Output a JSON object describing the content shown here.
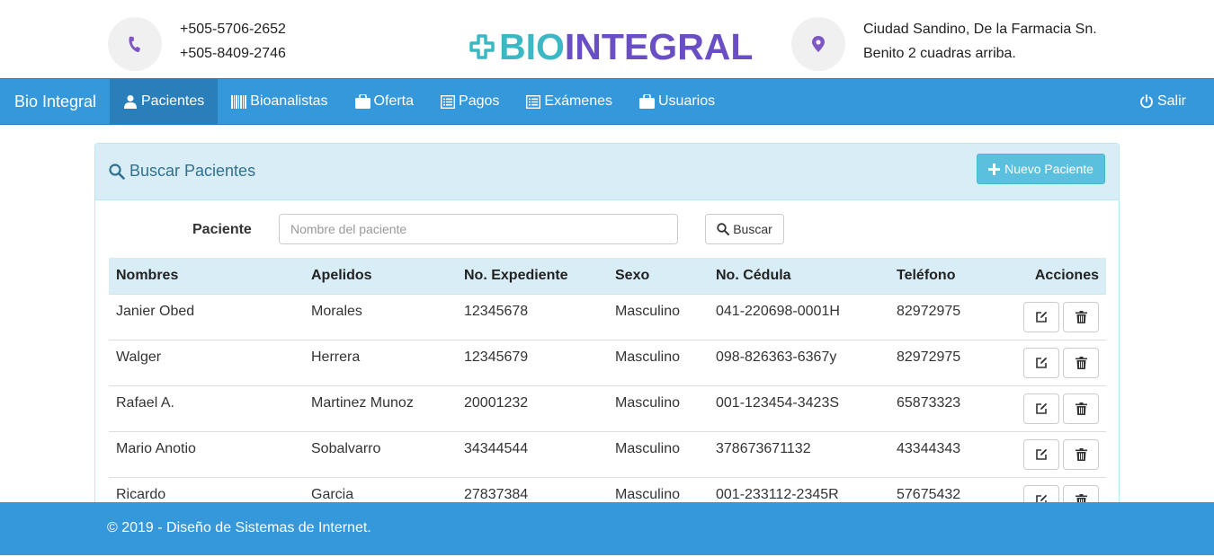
{
  "header": {
    "phones": [
      "+505-5706-2652",
      "+505-8409-2746"
    ],
    "brand_part1": "BIO",
    "brand_part2": "INTEGRAL",
    "address_lines": [
      "Ciudad Sandino, De la Farmacia Sn.",
      "Benito 2 cuadras arriba."
    ],
    "colors": {
      "brand_teal": "#3bb8c3",
      "brand_purple": "#6a4fc4",
      "icon_purple": "#7e57c2"
    }
  },
  "navbar": {
    "brand": "Bio Integral",
    "items": [
      {
        "label": "Pacientes",
        "icon": "user-icon",
        "active": true
      },
      {
        "label": "Bioanalistas",
        "icon": "barcode-icon",
        "active": false
      },
      {
        "label": "Oferta",
        "icon": "briefcase-icon",
        "active": false
      },
      {
        "label": "Pagos",
        "icon": "list-icon",
        "active": false
      },
      {
        "label": "Exámenes",
        "icon": "list-icon",
        "active": false
      },
      {
        "label": "Usuarios",
        "icon": "briefcase-icon",
        "active": false
      }
    ],
    "logout": "Salir",
    "color": "#3498db"
  },
  "panel": {
    "title": "Buscar Pacientes",
    "new_button": "Nuevo Paciente",
    "search_label": "Paciente",
    "search_placeholder": "Nombre del paciente",
    "search_button": "Buscar"
  },
  "table": {
    "columns": [
      "Nombres",
      "Apelidos",
      "No. Expediente",
      "Sexo",
      "No. Cédula",
      "Teléfono",
      "Acciones"
    ],
    "rows": [
      [
        "Janier Obed",
        "Morales",
        "12345678",
        "Masculino",
        "041-220698-0001H",
        "82972975"
      ],
      [
        "Walger",
        "Herrera",
        "12345679",
        "Masculino",
        "098-826363-6367y",
        "82972975"
      ],
      [
        "Rafael A.",
        "Martinez Munoz",
        "20001232",
        "Masculino",
        "001-123454-3423S",
        "65873323"
      ],
      [
        "Mario Anotio",
        "Sobalvarro",
        "34344544",
        "Masculino",
        "378673671132",
        "43344343"
      ],
      [
        "Ricardo",
        "Garcia",
        "27837384",
        "Masculino",
        "001-233112-2345R",
        "57675432"
      ]
    ]
  },
  "footer": {
    "text": "© 2019 - Diseño de Sistemas de Internet."
  }
}
